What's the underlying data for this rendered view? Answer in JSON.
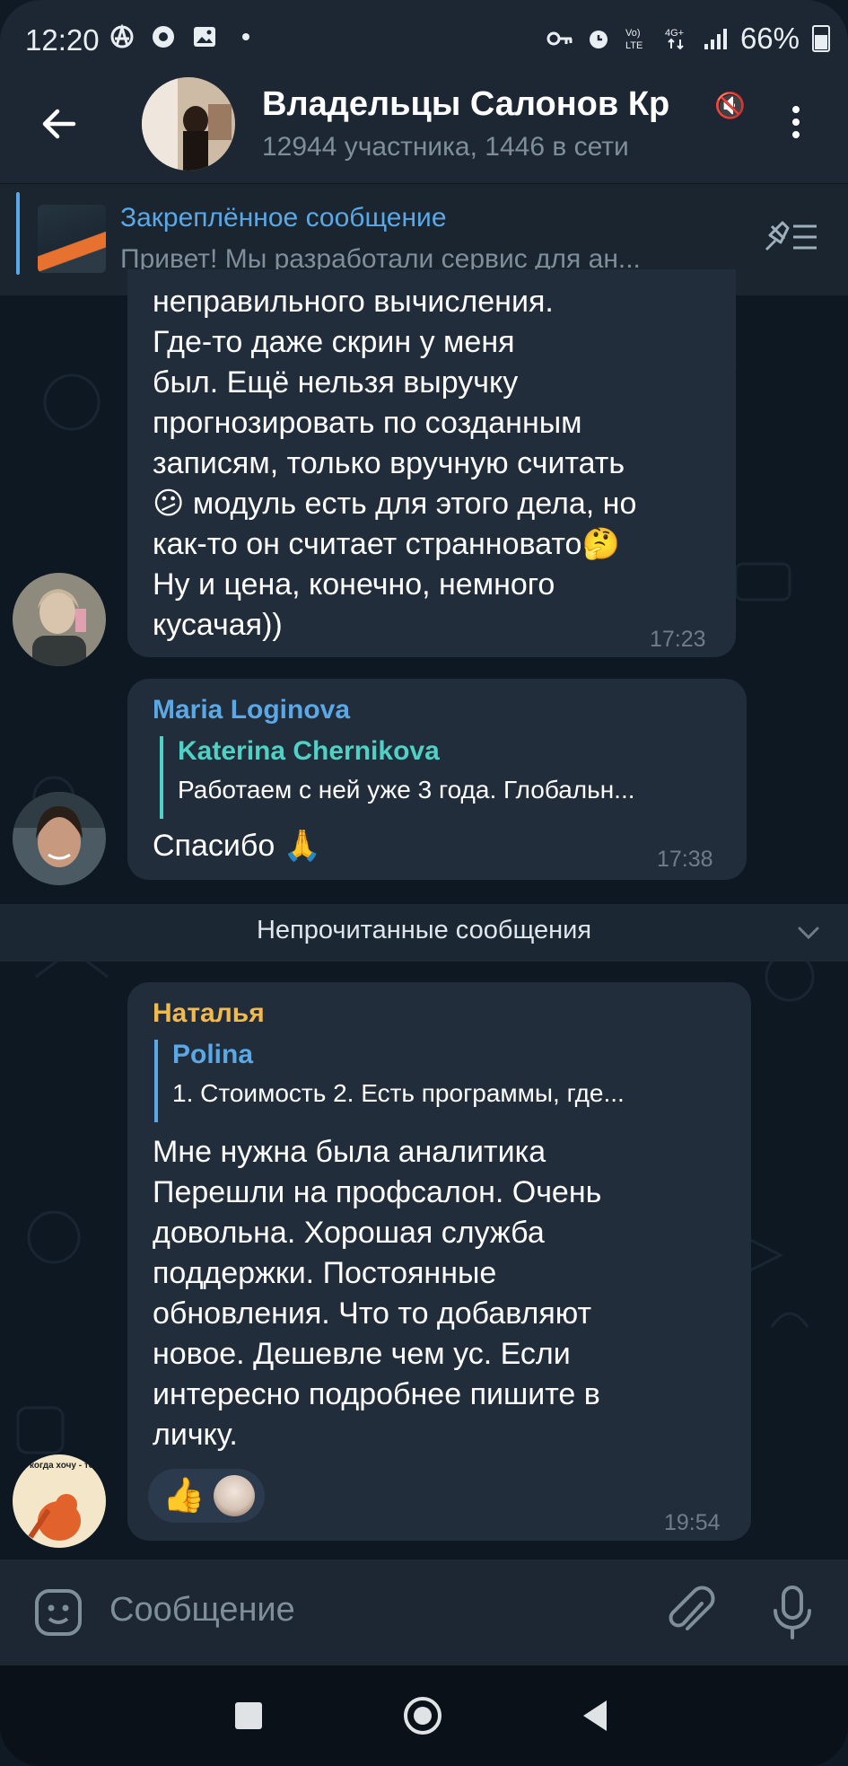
{
  "status_bar": {
    "time": "12:20",
    "battery": "66%",
    "icons": [
      "anarchy-icon",
      "chrome-icon",
      "gallery-icon",
      "dot-icon",
      "key-icon",
      "alarm-icon",
      "volte-icon",
      "4g-icon",
      "signal-icon",
      "battery-icon"
    ]
  },
  "header": {
    "title": "Владельцы Салонов Кр",
    "subtitle": "12944 участника, 1446 в сети"
  },
  "pinned": {
    "title": "Закреплённое сообщение",
    "text": "Привет!  Мы разработали сервис для ан..."
  },
  "messages": [
    {
      "lines": [
        "неправильного вычисления.",
        "Где-то даже скрин у меня",
        "был. Ещё нельзя выручку",
        "прогнозировать по созданным",
        "записям, только вручную считать",
        "модуль есть для этого дела, но",
        "как-то он считает странновато",
        "Ну и цена, конечно, немного",
        "кусачая))"
      ],
      "emoji_1": "😕",
      "emoji_2": "🤔",
      "time": "17:23"
    },
    {
      "sender": "Maria Loginova",
      "reply_name": "Katerina Chernikova",
      "reply_text": "Работаем с ней уже 3 года. Глобальн...",
      "text": "Спасибо",
      "emoji": "🙏",
      "time": "17:38"
    },
    {
      "sender": "Наталья",
      "reply_name": "Polina",
      "reply_text": "1. Стоимость  2. Есть программы, где...",
      "lines": [
        "Мне нужна была аналитика",
        "Перешли на профсалон. Очень",
        "довольна. Хорошая служба",
        "поддержки. Постоянные",
        "обновления. Что то добавляют",
        "новое. Дешевле чем ус. Если",
        "интересно подробнее пишите в",
        "личку."
      ],
      "reaction": "👍",
      "time": "19:54"
    }
  ],
  "avatar_text": "Моя жизнь: когда хочу - тогда и дура.",
  "unread_label": "Непрочитанные сообщения",
  "input": {
    "placeholder": "Сообщение"
  },
  "colors": {
    "accent": "#5aa8e6",
    "maria_name": "#5aa8e6",
    "katerina_name": "#4fd1c5",
    "natalya_name": "#f2b94b",
    "polina_name": "#5aa8e6",
    "bubble": "#212d3b",
    "background": "#0e1822"
  }
}
